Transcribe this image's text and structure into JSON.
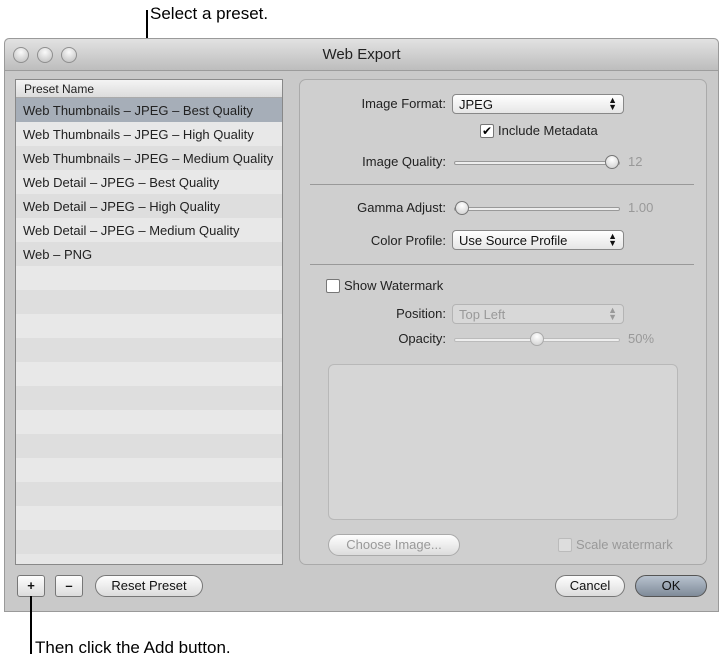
{
  "callouts": {
    "top": "Select a preset.",
    "bottom": "Then click the Add button."
  },
  "window": {
    "title": "Web Export"
  },
  "list": {
    "header": "Preset Name",
    "items": [
      "Web Thumbnails – JPEG – Best Quality",
      "Web Thumbnails – JPEG – High Quality",
      "Web Thumbnails – JPEG – Medium Quality",
      "Web Detail – JPEG – Best Quality",
      "Web Detail – JPEG – High Quality",
      "Web Detail – JPEG – Medium Quality",
      "Web – PNG"
    ],
    "selected_index": 0
  },
  "settings": {
    "image_format_label": "Image Format:",
    "image_format": "JPEG",
    "include_metadata_label": "Include Metadata",
    "include_metadata": true,
    "image_quality_label": "Image Quality:",
    "image_quality": "12",
    "image_quality_fraction": 1.0,
    "gamma_label": "Gamma Adjust:",
    "gamma": "1.00",
    "gamma_fraction": 0.0,
    "color_profile_label": "Color Profile:",
    "color_profile": "Use Source Profile",
    "show_watermark_label": "Show Watermark",
    "show_watermark": false,
    "position_label": "Position:",
    "position": "Top Left",
    "opacity_label": "Opacity:",
    "opacity": "50%",
    "opacity_fraction": 0.5,
    "choose_image": "Choose Image...",
    "scale_watermark": "Scale watermark"
  },
  "buttons": {
    "add": "+",
    "remove": "–",
    "reset": "Reset Preset",
    "cancel": "Cancel",
    "ok": "OK"
  }
}
